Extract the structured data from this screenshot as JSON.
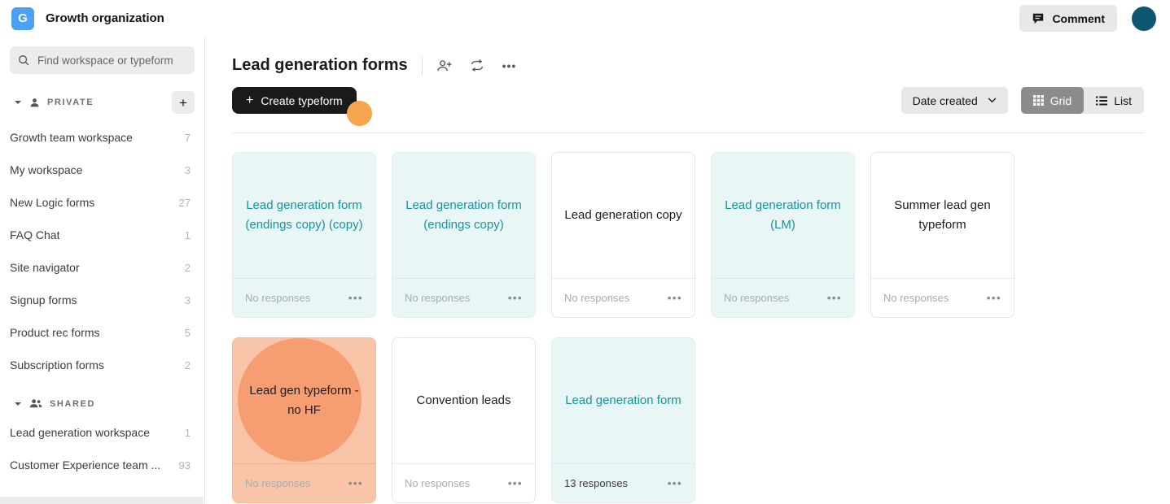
{
  "topbar": {
    "org_initial": "G",
    "org_name": "Growth organization",
    "comment_label": "Comment"
  },
  "icons": {
    "plus": "+",
    "ellipsis": "•••"
  },
  "sidebar": {
    "search_placeholder": "Find workspace or typeform",
    "sections": [
      {
        "label": "PRIVATE",
        "items": [
          {
            "label": "Growth team workspace",
            "count": "7"
          },
          {
            "label": "My workspace",
            "count": "3"
          },
          {
            "label": "New Logic forms",
            "count": "27"
          },
          {
            "label": "FAQ Chat",
            "count": "1"
          },
          {
            "label": "Site navigator",
            "count": "2"
          },
          {
            "label": "Signup forms",
            "count": "3"
          },
          {
            "label": "Product rec forms",
            "count": "5"
          },
          {
            "label": "Subscription forms",
            "count": "2"
          }
        ]
      },
      {
        "label": "SHARED",
        "items": [
          {
            "label": "Lead generation workspace",
            "count": "1"
          },
          {
            "label": "Customer Experience team ...",
            "count": "93"
          }
        ]
      }
    ]
  },
  "main": {
    "title": "Lead generation forms",
    "create_button": "Create typeform",
    "sort_label": "Date created",
    "view_grid": "Grid",
    "view_list": "List",
    "cards": [
      {
        "title": "Lead generation form (endings copy) (copy)",
        "responses": "No responses",
        "theme": "teal"
      },
      {
        "title": "Lead generation form (endings copy)",
        "responses": "No responses",
        "theme": "teal"
      },
      {
        "title": "Lead generation copy",
        "responses": "No responses",
        "theme": "white"
      },
      {
        "title": "Lead generation form (LM)",
        "responses": "No responses",
        "theme": "teal"
      },
      {
        "title": "Summer lead gen typeform",
        "responses": "No responses",
        "theme": "white"
      },
      {
        "title": "Lead gen typeform - no HF",
        "responses": "No responses",
        "theme": "salmon"
      },
      {
        "title": "Convention leads",
        "responses": "No responses",
        "theme": "white"
      },
      {
        "title": "Lead generation form",
        "responses": "13 responses",
        "theme": "teal"
      }
    ]
  },
  "colors": {
    "accent_teal": "#18939b",
    "card_teal_bg": "#e9f6f6",
    "card_salmon_bg": "#f8c5a9",
    "salmon_circle": "#f79d72",
    "click_indicator_orange": "#f6a44e",
    "logo_blue": "#4e9ff6",
    "avatar_teal": "#0e5671",
    "button_black": "#1a1a1a"
  }
}
